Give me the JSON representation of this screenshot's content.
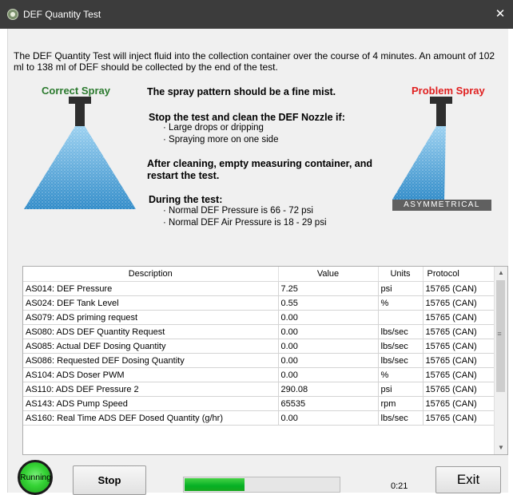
{
  "window": {
    "title": "DEF Quantity Test",
    "close_glyph": "✕"
  },
  "intro": "The DEF Quantity Test will inject fluid into the collection container over the course of 4 minutes. An amount of 102 ml to 138 ml of DEF should be collected by the end of the test.",
  "labels": {
    "correct_spray": "Correct Spray",
    "problem_spray": "Problem Spray",
    "asymmetrical": "ASYMMETRICAL"
  },
  "instructions": {
    "fine_mist": "The spray pattern should be a fine mist.",
    "stop_heading": "Stop the test and clean the DEF Nozzle if:",
    "stop_items": [
      "· Large drops or dripping",
      "· Spraying more on one side"
    ],
    "after_line1": "After cleaning, empty measuring container, and",
    "after_line2": "restart the test.",
    "during_heading": "During the test:",
    "during_items": [
      "· Normal DEF Pressure is 66 - 72 psi",
      "· Normal DEF Air Pressure is 18 - 29 psi"
    ]
  },
  "table": {
    "columns": [
      "Description",
      "Value",
      "Units",
      "Protocol"
    ],
    "rows": [
      [
        "AS014: DEF Pressure",
        "7.25",
        "psi",
        "15765 (CAN)"
      ],
      [
        "AS024: DEF Tank Level",
        "0.55",
        "%",
        "15765 (CAN)"
      ],
      [
        "AS079: ADS priming request",
        "0.00",
        "",
        "15765 (CAN)"
      ],
      [
        "AS080: ADS DEF Quantity Request",
        "0.00",
        "lbs/sec",
        "15765 (CAN)"
      ],
      [
        "AS085: Actual DEF Dosing Quantity",
        "0.00",
        "lbs/sec",
        "15765 (CAN)"
      ],
      [
        "AS086: Requested DEF Dosing Quantity",
        "0.00",
        "lbs/sec",
        "15765 (CAN)"
      ],
      [
        "AS104: ADS Doser PWM",
        "0.00",
        "%",
        "15765 (CAN)"
      ],
      [
        "AS110: ADS DEF Pressure 2",
        "290.08",
        "psi",
        "15765 (CAN)"
      ],
      [
        "AS143: ADS Pump Speed",
        "65535",
        "rpm",
        "15765 (CAN)"
      ],
      [
        "AS160: Real Time ADS DEF Dosed Quantity (g/hr)",
        "0.00",
        "lbs/sec",
        "15765 (CAN)"
      ]
    ]
  },
  "status": {
    "running_label": "Running",
    "stop_label": "Stop",
    "exit_label": "Exit",
    "elapsed": "0:21",
    "progress": 0.39
  },
  "colors": {
    "running_green": "#35d335",
    "correct_label": "#2b7a2e",
    "problem_label": "#e01e1e",
    "progress_green": "#06b025"
  }
}
